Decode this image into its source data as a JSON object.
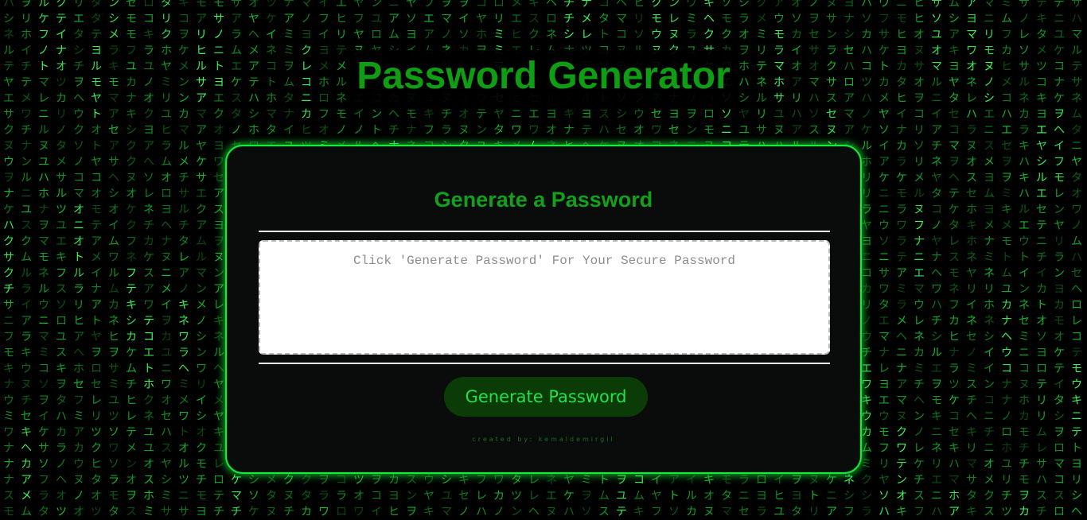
{
  "header": {
    "title": "Password Generator"
  },
  "card": {
    "heading": "Generate a Password",
    "password_output": {
      "value": "",
      "placeholder": "Click 'Generate Password' For Your Secure Password"
    },
    "generate_button_label": "Generate Password",
    "credit": "created by: kemaldemirgil"
  },
  "colors": {
    "accent_green": "#0f9d14",
    "neon_green": "#18e93b",
    "button_bg": "#0b3c08",
    "button_text": "#22e14a",
    "card_bg": "#0a0b0b",
    "page_bg": "#000000"
  },
  "background": {
    "effect": "matrix-code-rain",
    "glyphs": "アイウエオカキクケコサシスセソタチツテトナニヌネノハヒフヘホマミムメモヤユヨラリルレロワヲン"
  }
}
